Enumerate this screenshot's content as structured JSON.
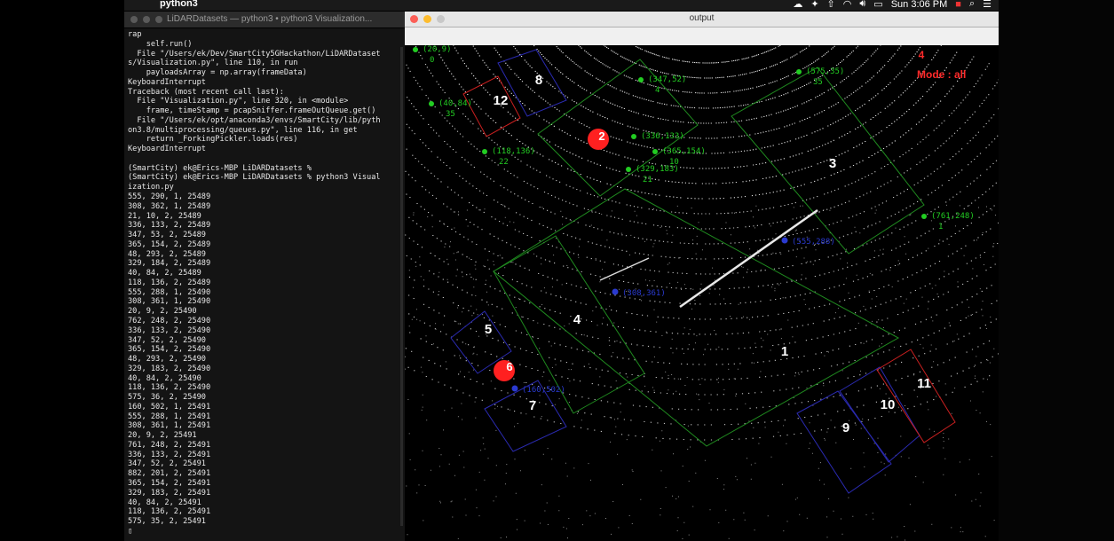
{
  "menubar": {
    "apple": "",
    "app_name": "python3",
    "clock": "Sun 3:06 PM"
  },
  "terminal": {
    "title": "LiDARDatasets — python3 • python3 Visualization...",
    "lines": [
      "rap",
      "    self.run()",
      "  File \"/Users/ek/Dev/SmartCity5GHackathon/LiDARDataset",
      "s/Visualization.py\", line 110, in run",
      "    payloadsArray = np.array(frameData)",
      "KeyboardInterrupt",
      "Traceback (most recent call last):",
      "  File \"Visualization.py\", line 320, in <module>",
      "    frame, timeStamp = pcapSniffer.frameOutQueue.get()",
      "  File \"/Users/ek/opt/anaconda3/envs/SmartCity/lib/pyth",
      "on3.8/multiprocessing/queues.py\", line 116, in get",
      "    return _ForkingPickler.loads(res)",
      "KeyboardInterrupt",
      "",
      "(SmartCity) ek@Erics-MBP LiDARDatasets %",
      "(SmartCity) ek@Erics-MBP LiDARDatasets % python3 Visual",
      "ization.py",
      "555, 290, 1, 25489",
      "308, 362, 1, 25489",
      "21, 10, 2, 25489",
      "336, 133, 2, 25489",
      "347, 53, 2, 25489",
      "365, 154, 2, 25489",
      "48, 293, 2, 25489",
      "329, 184, 2, 25489",
      "40, 84, 2, 25489",
      "118, 136, 2, 25489",
      "555, 288, 1, 25490",
      "308, 361, 1, 25490",
      "20, 9, 2, 25490",
      "762, 248, 2, 25490",
      "336, 133, 2, 25490",
      "347, 52, 2, 25490",
      "365, 154, 2, 25490",
      "48, 293, 2, 25490",
      "329, 183, 2, 25490",
      "40, 84, 2, 25490",
      "118, 136, 2, 25490",
      "575, 36, 2, 25490",
      "160, 502, 1, 25491",
      "555, 288, 1, 25491",
      "308, 361, 1, 25491",
      "20, 9, 2, 25491",
      "761, 248, 2, 25491",
      "336, 133, 2, 25491",
      "347, 52, 2, 25491",
      "882, 201, 2, 25491",
      "365, 154, 2, 25491",
      "329, 183, 2, 25491",
      "40, 84, 2, 25491",
      "118, 136, 2, 25491",
      "575, 35, 2, 25491",
      "▯"
    ]
  },
  "output_window": {
    "title": "output",
    "mode_label": "Mode : all",
    "mode_count": "4",
    "zones": [
      {
        "label": "1",
        "color": "#1f8a1f"
      },
      {
        "label": "2",
        "color": "#ff2020"
      },
      {
        "label": "3",
        "color": "#1f8a1f"
      },
      {
        "label": "4",
        "color": "#1f8a1f"
      },
      {
        "label": "5",
        "color": "#2222aa"
      },
      {
        "label": "6",
        "color": "#ff2020"
      },
      {
        "label": "7",
        "color": "#2222aa"
      },
      {
        "label": "8",
        "color": "#2222aa"
      },
      {
        "label": "9",
        "color": "#2222aa"
      },
      {
        "label": "10",
        "color": "#2222aa"
      },
      {
        "label": "11",
        "color": "#cc2020"
      },
      {
        "label": "12",
        "color": "#cc2020"
      }
    ],
    "green_points": [
      {
        "coord": "(20,9)",
        "id": "0"
      },
      {
        "coord": "(40,84)",
        "id": "35"
      },
      {
        "coord": "(118,136)",
        "id": "22"
      },
      {
        "coord": "(347,52)",
        "id": "4"
      },
      {
        "coord": "(336,133)",
        "id": ""
      },
      {
        "coord": "(365,154)",
        "id": "10"
      },
      {
        "coord": "(329,183)",
        "id": "21"
      },
      {
        "coord": "(575,35)",
        "id": "35"
      },
      {
        "coord": "(761,248)",
        "id": "1"
      }
    ],
    "blue_points": [
      {
        "coord": "(555,288)"
      },
      {
        "coord": "(308,361)"
      },
      {
        "coord": "(160,502)"
      }
    ],
    "colors": {
      "track_green": "#22cc22",
      "zone_green": "#1f8a1f",
      "zone_blue": "#2222aa",
      "zone_red": "#cc2020",
      "mode_red": "#ff2a2a"
    }
  }
}
